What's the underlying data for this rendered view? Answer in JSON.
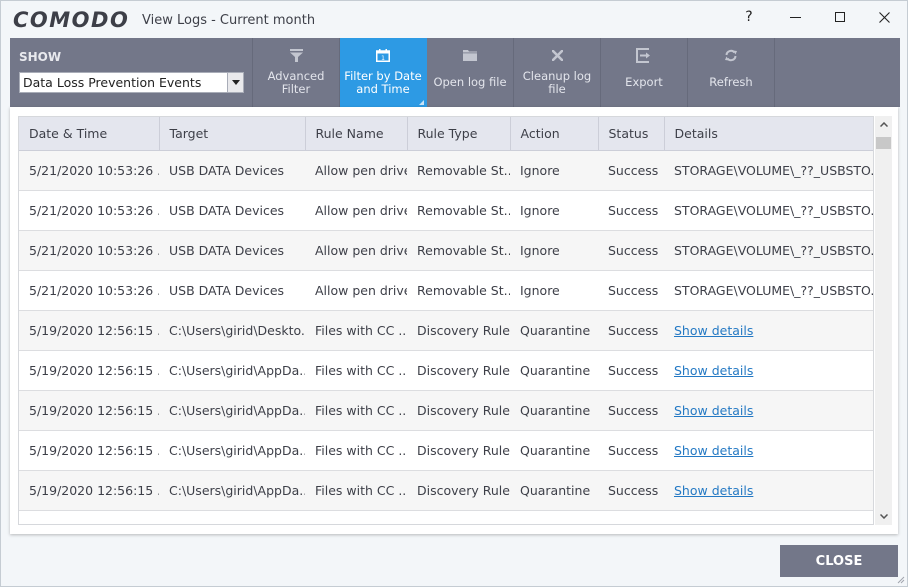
{
  "window": {
    "logo": "COMODO",
    "title": "View Logs - Current month",
    "controls": {
      "help": "?"
    }
  },
  "toolbar": {
    "show_label": "SHOW",
    "show_selected": "Data Loss Prevention Events",
    "buttons": [
      {
        "id": "advanced-filter",
        "label_line1": "Advanced",
        "label_line2": "Filter",
        "icon": "filter-icon",
        "active": false
      },
      {
        "id": "filter-by-date",
        "label_line1": "Filter by Date",
        "label_line2": "and Time",
        "icon": "calendar-icon",
        "active": true
      },
      {
        "id": "open-log-file",
        "label": "Open log file",
        "icon": "folder-icon",
        "active": false
      },
      {
        "id": "cleanup-log-file",
        "label_line1": "Cleanup log",
        "label_line2": "file",
        "icon": "x-icon",
        "active": false
      },
      {
        "id": "export",
        "label": "Export",
        "icon": "export-icon",
        "active": false
      },
      {
        "id": "refresh",
        "label": "Refresh",
        "icon": "refresh-icon",
        "active": false
      }
    ],
    "calendar_day": "1"
  },
  "table": {
    "columns": [
      "Date & Time",
      "Target",
      "Rule Name",
      "Rule Type",
      "Action",
      "Status",
      "Details"
    ],
    "rows": [
      {
        "date": "5/21/2020 10:53:26 ...",
        "target": "USB DATA Devices",
        "rule_name": "Allow pen drive",
        "rule_type": "Removable St...",
        "action": "Ignore",
        "status": "Success",
        "details": "STORAGE\\VOLUME\\_??_USBSTO...",
        "details_is_link": false
      },
      {
        "date": "5/21/2020 10:53:26 ...",
        "target": "USB DATA Devices",
        "rule_name": "Allow pen drive",
        "rule_type": "Removable St...",
        "action": "Ignore",
        "status": "Success",
        "details": "STORAGE\\VOLUME\\_??_USBSTO...",
        "details_is_link": false
      },
      {
        "date": "5/21/2020 10:53:26 ...",
        "target": "USB DATA Devices",
        "rule_name": "Allow pen drive",
        "rule_type": "Removable St...",
        "action": "Ignore",
        "status": "Success",
        "details": "STORAGE\\VOLUME\\_??_USBSTO...",
        "details_is_link": false
      },
      {
        "date": "5/21/2020 10:53:26 ...",
        "target": "USB DATA Devices",
        "rule_name": "Allow pen drive",
        "rule_type": "Removable St...",
        "action": "Ignore",
        "status": "Success",
        "details": "STORAGE\\VOLUME\\_??_USBSTO...",
        "details_is_link": false
      },
      {
        "date": "5/19/2020 12:56:15 ...",
        "target": "C:\\Users\\girid\\Deskto...",
        "rule_name": "Files with CC ...",
        "rule_type": "Discovery Rule",
        "action": "Quarantine",
        "status": "Success",
        "details": "Show details",
        "details_is_link": true
      },
      {
        "date": "5/19/2020 12:56:15 ...",
        "target": "C:\\Users\\girid\\AppDa...",
        "rule_name": "Files with CC ...",
        "rule_type": "Discovery Rule",
        "action": "Quarantine",
        "status": "Success",
        "details": "Show details",
        "details_is_link": true
      },
      {
        "date": "5/19/2020 12:56:15 ...",
        "target": "C:\\Users\\girid\\AppDa...",
        "rule_name": "Files with CC ...",
        "rule_type": "Discovery Rule",
        "action": "Quarantine",
        "status": "Success",
        "details": "Show details",
        "details_is_link": true
      },
      {
        "date": "5/19/2020 12:56:15 ...",
        "target": "C:\\Users\\girid\\AppDa...",
        "rule_name": "Files with CC ...",
        "rule_type": "Discovery Rule",
        "action": "Quarantine",
        "status": "Success",
        "details": "Show details",
        "details_is_link": true
      },
      {
        "date": "5/19/2020 12:56:15 ...",
        "target": "C:\\Users\\girid\\AppDa...",
        "rule_name": "Files with CC ...",
        "rule_type": "Discovery Rule",
        "action": "Quarantine",
        "status": "Success",
        "details": "Show details",
        "details_is_link": true
      },
      {
        "date": "",
        "target": "",
        "rule_name": "",
        "rule_type": "",
        "action": "",
        "status": "",
        "details": "",
        "details_is_link": false
      }
    ]
  },
  "footer": {
    "close_label": "CLOSE"
  },
  "colors": {
    "toolbar_bg": "#737789",
    "active_tool": "#2d9ae4",
    "link": "#2479c4",
    "window_bg": "#f3f6f9"
  }
}
